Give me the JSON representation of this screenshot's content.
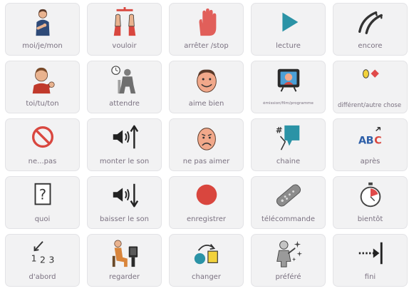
{
  "board": {
    "cells": [
      {
        "label": "moi/je/mon",
        "icon": "person-pointing-self-icon"
      },
      {
        "label": "vouloir",
        "icon": "hands-reaching-icon"
      },
      {
        "label": "arrêter /stop",
        "icon": "stop-hand-icon"
      },
      {
        "label": "lecture",
        "icon": "play-icon"
      },
      {
        "label": "encore",
        "icon": "again-strokes-icon"
      },
      {
        "label": "toi/tu/ton",
        "icon": "person-pointing-you-icon"
      },
      {
        "label": "attendre",
        "icon": "person-waiting-clock-icon"
      },
      {
        "label": "aime bien",
        "icon": "smiling-face-icon"
      },
      {
        "label": "émission/film/programme",
        "icon": "television-icon"
      },
      {
        "label": "différent/autre chose",
        "icon": "different-shapes-icon"
      },
      {
        "label": "ne...pas",
        "icon": "no-sign-icon"
      },
      {
        "label": "monter le son",
        "icon": "volume-up-icon"
      },
      {
        "label": "ne pas aimer",
        "icon": "frowning-face-icon"
      },
      {
        "label": "chaine",
        "icon": "channel-icon",
        "icon_text": "#"
      },
      {
        "label": "après",
        "icon": "alphabet-after-icon",
        "icon_text": [
          "A",
          "B",
          "C"
        ]
      },
      {
        "label": "quoi",
        "icon": "question-mark-icon",
        "icon_text": "?"
      },
      {
        "label": "baisser le son",
        "icon": "volume-down-icon"
      },
      {
        "label": "enregistrer",
        "icon": "record-icon"
      },
      {
        "label": "télécommande",
        "icon": "remote-control-icon"
      },
      {
        "label": "bientôt",
        "icon": "stopwatch-icon"
      },
      {
        "label": "d'abord",
        "icon": "first-number-icon",
        "icon_text": [
          "1",
          "2",
          "3"
        ]
      },
      {
        "label": "regarder",
        "icon": "person-watching-tv-icon"
      },
      {
        "label": "changer",
        "icon": "change-shapes-icon"
      },
      {
        "label": "préféré",
        "icon": "favorite-person-icon"
      },
      {
        "label": "fini",
        "icon": "finished-arrow-icon"
      }
    ]
  },
  "colors": {
    "card_background": "#f2f2f3",
    "card_border": "#e3e3e6",
    "label_text": "#7a7180",
    "accent_red": "#d9473f",
    "accent_teal": "#2b93a6",
    "accent_yellow": "#f2d23c"
  }
}
